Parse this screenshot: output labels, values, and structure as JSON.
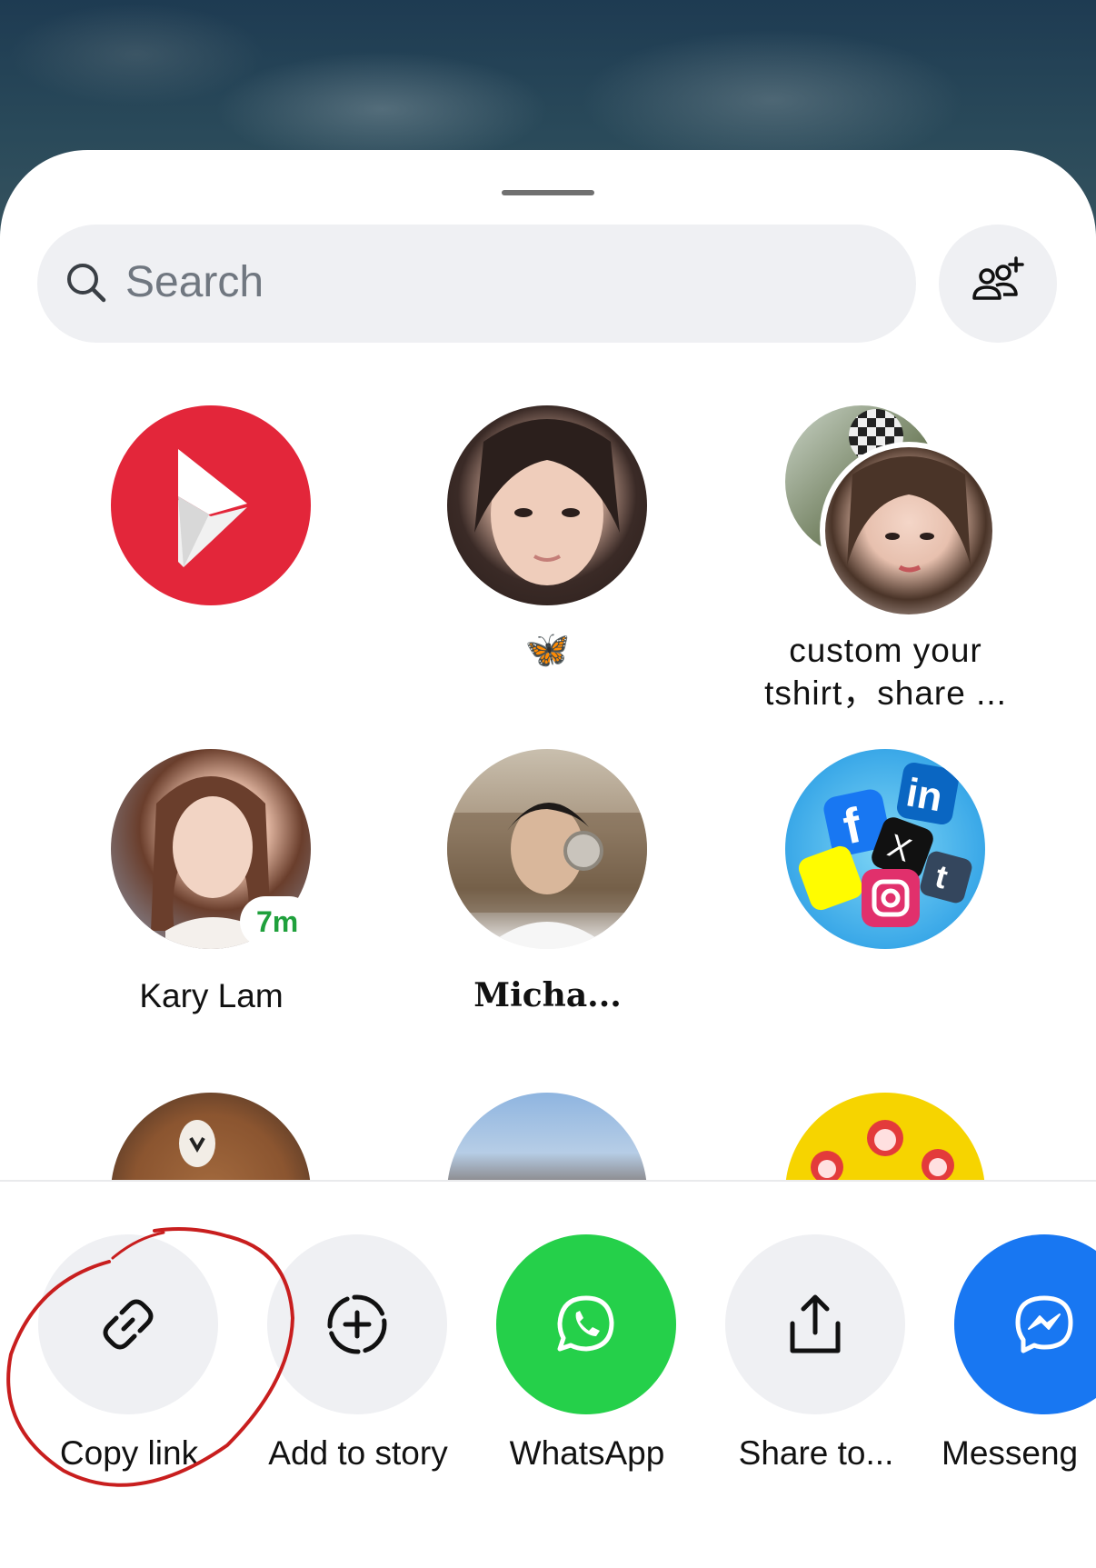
{
  "search": {
    "placeholder": "Search"
  },
  "recipients": [
    {
      "name": "",
      "avatar": "red-play-logo"
    },
    {
      "name": "🦋",
      "avatar": "woman-selfie"
    },
    {
      "name": "custom your\ntshirt，share ...",
      "avatar": "group-two-people"
    },
    {
      "name": "Kary Lam",
      "avatar": "woman-portrait",
      "badge": "7m"
    },
    {
      "name": "Micha...",
      "avatar": "man-headphones"
    },
    {
      "name": "",
      "avatar": "social-media-icons"
    },
    {
      "name": "",
      "avatar": "brown-bear"
    },
    {
      "name": "",
      "avatar": "street-scene"
    },
    {
      "name": "",
      "avatar": "yellow-cartoon"
    }
  ],
  "actions": [
    {
      "label": "Copy link",
      "icon": "link-icon"
    },
    {
      "label": "Add to story",
      "icon": "add-story-icon"
    },
    {
      "label": "WhatsApp",
      "icon": "whatsapp-icon",
      "color": "#25d04a"
    },
    {
      "label": "Share to...",
      "icon": "share-icon"
    },
    {
      "label": "Messeng",
      "icon": "messenger-icon",
      "color": "#1877f2"
    }
  ],
  "colors": {
    "annotation": "#c81e1e",
    "whatsapp": "#25d04a",
    "messenger": "#1877f2",
    "accent_red": "#e3263a"
  }
}
